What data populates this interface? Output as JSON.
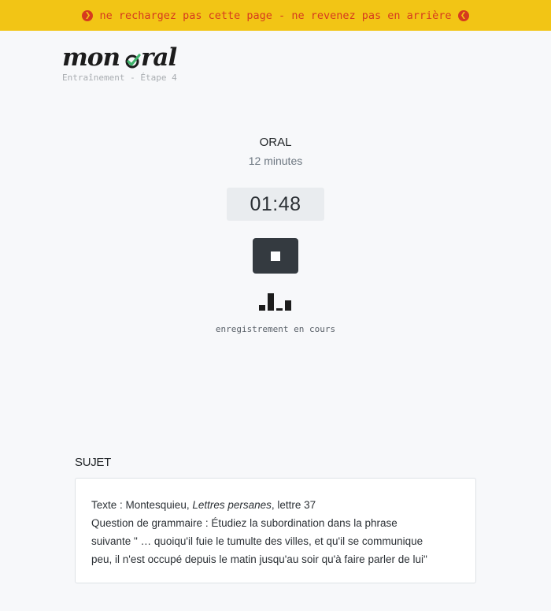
{
  "warning": {
    "text": "ne rechargez pas cette page - ne revenez pas en arrière",
    "left_icon": "chevron-circle-right-icon",
    "right_icon": "chevron-circle-left-icon",
    "color": "#d63a1f",
    "background": "#f2c515"
  },
  "logo": {
    "word1": "mon",
    "word2": "ral",
    "subtitle": "Entraînement - Étape 4",
    "check_color": "#3fb36b"
  },
  "oral": {
    "title": "ORAL",
    "duration": "12 minutes",
    "timer": "01:48"
  },
  "controls": {
    "stop_icon": "stop-icon"
  },
  "audio_levels": [
    0.32,
    1.0,
    0.14,
    0.6
  ],
  "status": "enregistrement en cours",
  "subject": {
    "heading": "SUJET",
    "text_prefix": "Texte : Montesquieu, ",
    "text_title": "Lettres persanes",
    "text_suffix": ", lettre 37",
    "question_line1": "Question de grammaire : Étudiez la subordination dans la phrase",
    "question_line2": "suivante \" … quoiqu'il fuie le tumulte des villes, et qu'il se communique",
    "question_line3": "peu, il n'est occupé depuis le matin jusqu'au soir qu'à faire parler de lui\""
  }
}
